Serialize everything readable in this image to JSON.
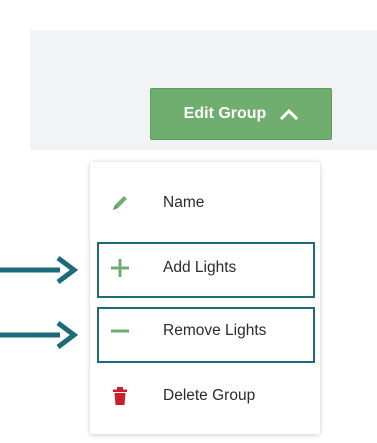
{
  "toolbar": {
    "edit_group_label": "Edit Group",
    "edit_group_icon": "chevron-up-icon"
  },
  "menu": {
    "items": [
      {
        "label": "Name",
        "icon": "pencil-icon",
        "icon_color": "#6fae6e"
      },
      {
        "label": "Add Lights",
        "icon": "plus-icon",
        "icon_color": "#6fae6e"
      },
      {
        "label": "Remove Lights",
        "icon": "minus-icon",
        "icon_color": "#6fae6e"
      },
      {
        "label": "Delete Group",
        "icon": "trash-icon",
        "icon_color": "#c8202e"
      }
    ]
  },
  "annotations": {
    "arrow_color": "#1d6a7a",
    "highlight_color": "#1d6a7a",
    "highlighted_items": [
      "Add Lights",
      "Remove Lights"
    ]
  },
  "colors": {
    "header_background": "#f1f3f4",
    "button_green": "#6fae6e"
  }
}
